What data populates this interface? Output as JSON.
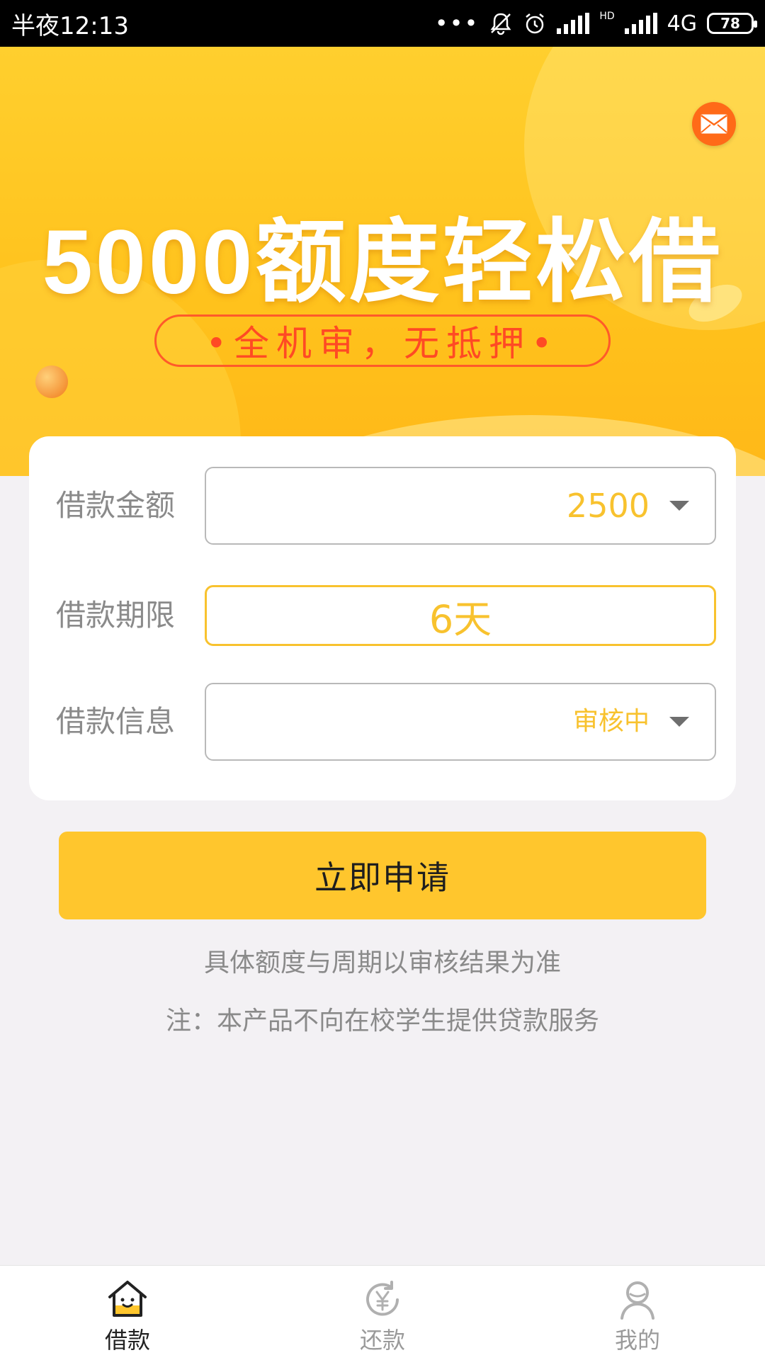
{
  "status_bar": {
    "time": "半夜12:13",
    "dots": "•••",
    "network": "4G",
    "hd": "HD",
    "battery": "78"
  },
  "banner": {
    "headline": "5000额度轻松借",
    "tagline": "•全机审，无抵押•",
    "mail_icon": "mail-icon"
  },
  "form": {
    "amount": {
      "label": "借款金额",
      "value": "2500"
    },
    "term": {
      "label": "借款期限",
      "value": "6天"
    },
    "info": {
      "label": "借款信息",
      "value": "审核中"
    }
  },
  "apply_button": "立即申请",
  "notes": {
    "line1": "具体额度与周期以审核结果为准",
    "line2": "注：本产品不向在校学生提供贷款服务"
  },
  "bottom_nav": [
    {
      "label": "借款",
      "icon": "house-smile-icon",
      "active": true
    },
    {
      "label": "还款",
      "icon": "yen-refresh-icon",
      "active": false
    },
    {
      "label": "我的",
      "icon": "user-icon",
      "active": false
    }
  ],
  "colors": {
    "accent": "#ffc62d",
    "value_text": "#f8c22e",
    "tagline": "#ff4a24",
    "mail_bg": "#ff6a18"
  }
}
